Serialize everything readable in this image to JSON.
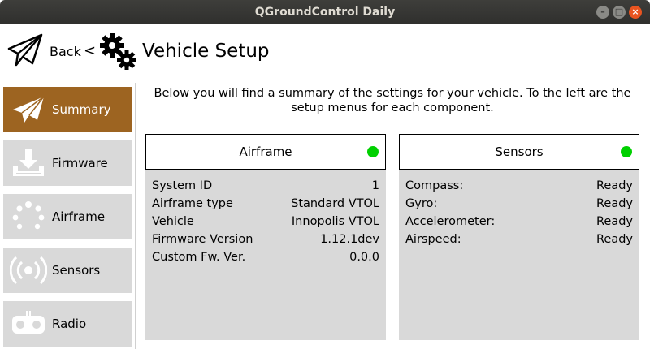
{
  "window": {
    "title": "QGroundControl Daily"
  },
  "header": {
    "back_label": "Back",
    "back_caret": "<",
    "title": "Vehicle Setup"
  },
  "sidebar": {
    "items": [
      {
        "label": "Summary",
        "icon": "paper-plane-icon",
        "active": true
      },
      {
        "label": "Firmware",
        "icon": "download-icon",
        "active": false
      },
      {
        "label": "Airframe",
        "icon": "airframe-icon",
        "active": false
      },
      {
        "label": "Sensors",
        "icon": "radio-waves-icon",
        "active": false
      },
      {
        "label": "Radio",
        "icon": "controller-icon",
        "active": false
      }
    ]
  },
  "intro": "Below you will find a summary of the settings for your vehicle. To the left are the setup menus for each component.",
  "panels": {
    "airframe": {
      "title": "Airframe",
      "status_color": "#00d000",
      "rows": [
        {
          "label": "System ID",
          "value": "1"
        },
        {
          "label": "Airframe type",
          "value": "Standard VTOL"
        },
        {
          "label": "Vehicle",
          "value": "Innopolis VTOL"
        },
        {
          "label": "Firmware Version",
          "value": "1.12.1dev"
        },
        {
          "label": "Custom Fw. Ver.",
          "value": "0.0.0"
        }
      ]
    },
    "sensors": {
      "title": "Sensors",
      "status_color": "#00d000",
      "rows": [
        {
          "label": "Compass:",
          "value": "Ready"
        },
        {
          "label": "Gyro:",
          "value": "Ready"
        },
        {
          "label": "Accelerometer:",
          "value": "Ready"
        },
        {
          "label": "Airspeed:",
          "value": "Ready"
        }
      ]
    }
  },
  "colors": {
    "accent": "#9d6421",
    "panel_bg": "#d9d9d9",
    "status_ok": "#00d000"
  }
}
